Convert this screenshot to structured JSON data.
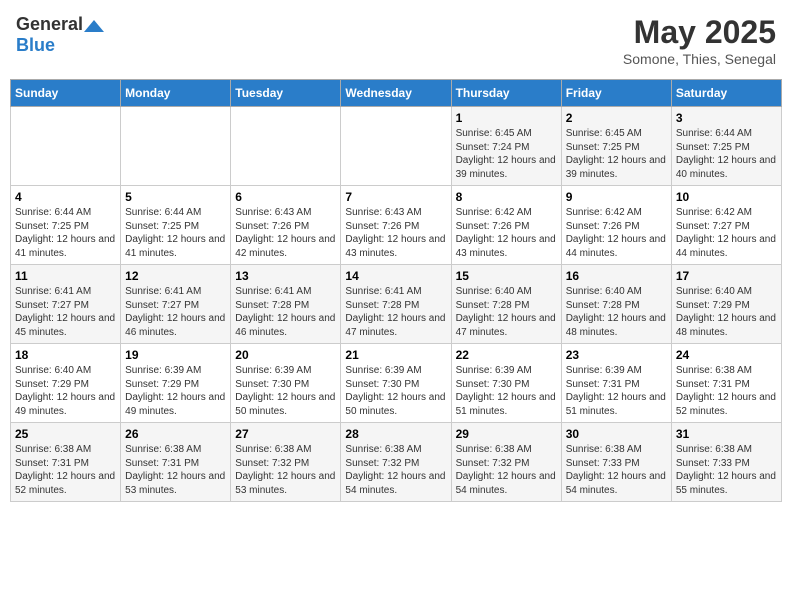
{
  "header": {
    "logo_general": "General",
    "logo_blue": "Blue",
    "month_title": "May 2025",
    "subtitle": "Somone, Thies, Senegal"
  },
  "days_of_week": [
    "Sunday",
    "Monday",
    "Tuesday",
    "Wednesday",
    "Thursday",
    "Friday",
    "Saturday"
  ],
  "weeks": [
    [
      {
        "day": "",
        "sunrise": "",
        "sunset": "",
        "daylight": ""
      },
      {
        "day": "",
        "sunrise": "",
        "sunset": "",
        "daylight": ""
      },
      {
        "day": "",
        "sunrise": "",
        "sunset": "",
        "daylight": ""
      },
      {
        "day": "",
        "sunrise": "",
        "sunset": "",
        "daylight": ""
      },
      {
        "day": "1",
        "sunrise": "Sunrise: 6:45 AM",
        "sunset": "Sunset: 7:24 PM",
        "daylight": "Daylight: 12 hours and 39 minutes."
      },
      {
        "day": "2",
        "sunrise": "Sunrise: 6:45 AM",
        "sunset": "Sunset: 7:25 PM",
        "daylight": "Daylight: 12 hours and 39 minutes."
      },
      {
        "day": "3",
        "sunrise": "Sunrise: 6:44 AM",
        "sunset": "Sunset: 7:25 PM",
        "daylight": "Daylight: 12 hours and 40 minutes."
      }
    ],
    [
      {
        "day": "4",
        "sunrise": "Sunrise: 6:44 AM",
        "sunset": "Sunset: 7:25 PM",
        "daylight": "Daylight: 12 hours and 41 minutes."
      },
      {
        "day": "5",
        "sunrise": "Sunrise: 6:44 AM",
        "sunset": "Sunset: 7:25 PM",
        "daylight": "Daylight: 12 hours and 41 minutes."
      },
      {
        "day": "6",
        "sunrise": "Sunrise: 6:43 AM",
        "sunset": "Sunset: 7:26 PM",
        "daylight": "Daylight: 12 hours and 42 minutes."
      },
      {
        "day": "7",
        "sunrise": "Sunrise: 6:43 AM",
        "sunset": "Sunset: 7:26 PM",
        "daylight": "Daylight: 12 hours and 43 minutes."
      },
      {
        "day": "8",
        "sunrise": "Sunrise: 6:42 AM",
        "sunset": "Sunset: 7:26 PM",
        "daylight": "Daylight: 12 hours and 43 minutes."
      },
      {
        "day": "9",
        "sunrise": "Sunrise: 6:42 AM",
        "sunset": "Sunset: 7:26 PM",
        "daylight": "Daylight: 12 hours and 44 minutes."
      },
      {
        "day": "10",
        "sunrise": "Sunrise: 6:42 AM",
        "sunset": "Sunset: 7:27 PM",
        "daylight": "Daylight: 12 hours and 44 minutes."
      }
    ],
    [
      {
        "day": "11",
        "sunrise": "Sunrise: 6:41 AM",
        "sunset": "Sunset: 7:27 PM",
        "daylight": "Daylight: 12 hours and 45 minutes."
      },
      {
        "day": "12",
        "sunrise": "Sunrise: 6:41 AM",
        "sunset": "Sunset: 7:27 PM",
        "daylight": "Daylight: 12 hours and 46 minutes."
      },
      {
        "day": "13",
        "sunrise": "Sunrise: 6:41 AM",
        "sunset": "Sunset: 7:28 PM",
        "daylight": "Daylight: 12 hours and 46 minutes."
      },
      {
        "day": "14",
        "sunrise": "Sunrise: 6:41 AM",
        "sunset": "Sunset: 7:28 PM",
        "daylight": "Daylight: 12 hours and 47 minutes."
      },
      {
        "day": "15",
        "sunrise": "Sunrise: 6:40 AM",
        "sunset": "Sunset: 7:28 PM",
        "daylight": "Daylight: 12 hours and 47 minutes."
      },
      {
        "day": "16",
        "sunrise": "Sunrise: 6:40 AM",
        "sunset": "Sunset: 7:28 PM",
        "daylight": "Daylight: 12 hours and 48 minutes."
      },
      {
        "day": "17",
        "sunrise": "Sunrise: 6:40 AM",
        "sunset": "Sunset: 7:29 PM",
        "daylight": "Daylight: 12 hours and 48 minutes."
      }
    ],
    [
      {
        "day": "18",
        "sunrise": "Sunrise: 6:40 AM",
        "sunset": "Sunset: 7:29 PM",
        "daylight": "Daylight: 12 hours and 49 minutes."
      },
      {
        "day": "19",
        "sunrise": "Sunrise: 6:39 AM",
        "sunset": "Sunset: 7:29 PM",
        "daylight": "Daylight: 12 hours and 49 minutes."
      },
      {
        "day": "20",
        "sunrise": "Sunrise: 6:39 AM",
        "sunset": "Sunset: 7:30 PM",
        "daylight": "Daylight: 12 hours and 50 minutes."
      },
      {
        "day": "21",
        "sunrise": "Sunrise: 6:39 AM",
        "sunset": "Sunset: 7:30 PM",
        "daylight": "Daylight: 12 hours and 50 minutes."
      },
      {
        "day": "22",
        "sunrise": "Sunrise: 6:39 AM",
        "sunset": "Sunset: 7:30 PM",
        "daylight": "Daylight: 12 hours and 51 minutes."
      },
      {
        "day": "23",
        "sunrise": "Sunrise: 6:39 AM",
        "sunset": "Sunset: 7:31 PM",
        "daylight": "Daylight: 12 hours and 51 minutes."
      },
      {
        "day": "24",
        "sunrise": "Sunrise: 6:38 AM",
        "sunset": "Sunset: 7:31 PM",
        "daylight": "Daylight: 12 hours and 52 minutes."
      }
    ],
    [
      {
        "day": "25",
        "sunrise": "Sunrise: 6:38 AM",
        "sunset": "Sunset: 7:31 PM",
        "daylight": "Daylight: 12 hours and 52 minutes."
      },
      {
        "day": "26",
        "sunrise": "Sunrise: 6:38 AM",
        "sunset": "Sunset: 7:31 PM",
        "daylight": "Daylight: 12 hours and 53 minutes."
      },
      {
        "day": "27",
        "sunrise": "Sunrise: 6:38 AM",
        "sunset": "Sunset: 7:32 PM",
        "daylight": "Daylight: 12 hours and 53 minutes."
      },
      {
        "day": "28",
        "sunrise": "Sunrise: 6:38 AM",
        "sunset": "Sunset: 7:32 PM",
        "daylight": "Daylight: 12 hours and 54 minutes."
      },
      {
        "day": "29",
        "sunrise": "Sunrise: 6:38 AM",
        "sunset": "Sunset: 7:32 PM",
        "daylight": "Daylight: 12 hours and 54 minutes."
      },
      {
        "day": "30",
        "sunrise": "Sunrise: 6:38 AM",
        "sunset": "Sunset: 7:33 PM",
        "daylight": "Daylight: 12 hours and 54 minutes."
      },
      {
        "day": "31",
        "sunrise": "Sunrise: 6:38 AM",
        "sunset": "Sunset: 7:33 PM",
        "daylight": "Daylight: 12 hours and 55 minutes."
      }
    ]
  ]
}
